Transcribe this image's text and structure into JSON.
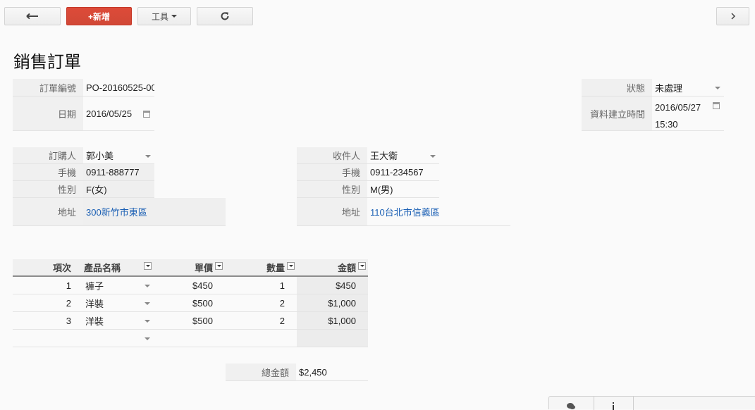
{
  "toolbar": {
    "back_icon": "arrow-left-icon",
    "new_label": "+新增",
    "tools_label": "工具",
    "refresh_icon": "refresh-icon",
    "next_icon": "chevron-right-icon"
  },
  "page_title": "銷售訂單",
  "header_left": {
    "order_no_label": "訂單編號",
    "order_no_value": "PO-20160525-00",
    "date_label": "日期",
    "date_value": "2016/05/25"
  },
  "header_right": {
    "status_label": "狀態",
    "status_value": "未處理",
    "created_label": "資料建立時間",
    "created_date": "2016/05/27",
    "created_time": "15:30"
  },
  "buyer": {
    "name_label": "訂購人",
    "name_value": "郭小美",
    "phone_label": "手機",
    "phone_value": "0911-888777",
    "gender_label": "性別",
    "gender_value": "F(女)",
    "address_label": "地址",
    "address_value": "300新竹市東區"
  },
  "receiver": {
    "name_label": "收件人",
    "name_value": "王大衛",
    "phone_label": "手機",
    "phone_value": "0911-234567",
    "gender_label": "性別",
    "gender_value": "M(男)",
    "address_label": "地址",
    "address_value": "110台北市信義區"
  },
  "items_table": {
    "columns": [
      "項次",
      "產品名稱",
      "單價",
      "數量",
      "金額"
    ],
    "rows": [
      {
        "no": "1",
        "product": "褲子",
        "price": "$450",
        "qty": "1",
        "amount": "$450"
      },
      {
        "no": "2",
        "product": "洋裝",
        "price": "$500",
        "qty": "2",
        "amount": "$1,000"
      },
      {
        "no": "3",
        "product": "洋裝",
        "price": "$500",
        "qty": "2",
        "amount": "$1,000"
      }
    ]
  },
  "total": {
    "label": "總金額",
    "value": "$2,450"
  },
  "bottom_bar": {
    "comment_icon": "comment-icon",
    "info_icon": "info-icon"
  }
}
